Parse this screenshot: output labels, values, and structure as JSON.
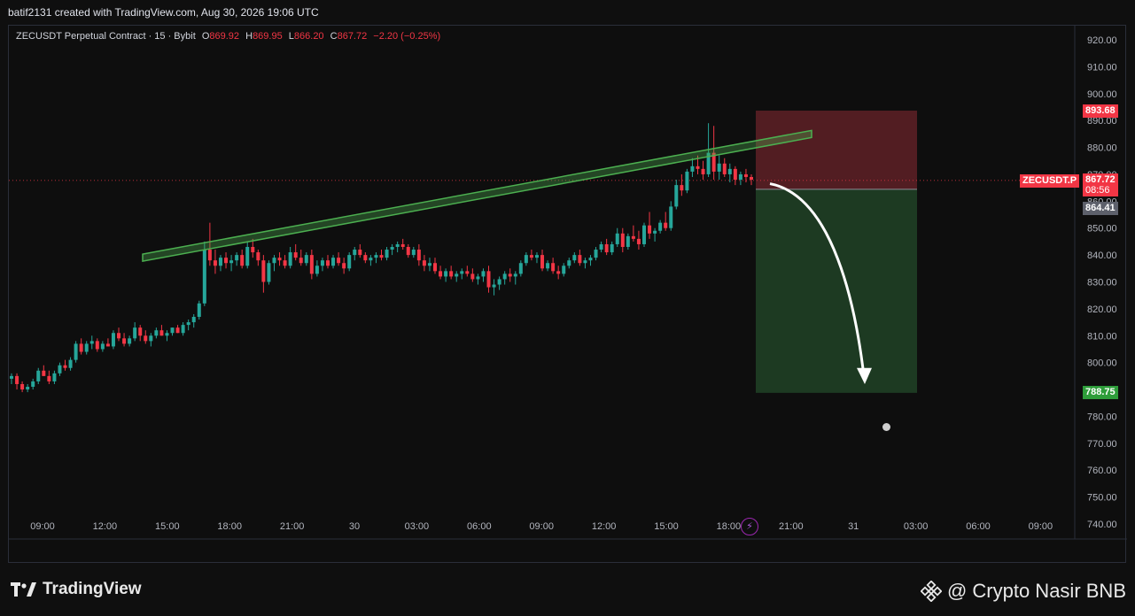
{
  "header": {
    "text": "batif2131 created with TradingView.com, Aug 30, 2026 19:06 UTC"
  },
  "legend": {
    "symbol": "ZECUSDT Perpetual Contract · 15 · Bybit",
    "o_key": "O",
    "o_val": "869.92",
    "h_key": "H",
    "h_val": "869.95",
    "l_key": "L",
    "l_val": "866.20",
    "c_key": "C",
    "c_val": "867.72",
    "change": "−2.20 (−0.25%)"
  },
  "price_axis": {
    "ticks": [
      "920.00",
      "910.00",
      "900.00",
      "890.00",
      "880.00",
      "870.00",
      "860.00",
      "850.00",
      "840.00",
      "830.00",
      "820.00",
      "810.00",
      "800.00",
      "790.00",
      "780.00",
      "770.00",
      "760.00",
      "750.00",
      "740.00"
    ]
  },
  "time_axis": {
    "ticks": [
      "09:00",
      "12:00",
      "15:00",
      "18:00",
      "21:00",
      "30",
      "03:00",
      "06:00",
      "09:00",
      "12:00",
      "15:00",
      "18:00",
      "21:00",
      "31",
      "03:00",
      "06:00",
      "09:00"
    ]
  },
  "price_tags": {
    "stop": "893.68",
    "symbol_label": "ZECUSDT.P",
    "last": "867.72",
    "countdown": "08:56",
    "entry": "864.41",
    "target": "788.75"
  },
  "colors": {
    "up": "#26a69a",
    "down": "#f23645",
    "trendline": "#4caf50",
    "stop_zone": "#5a1f25",
    "target_zone": "#1f3d24"
  },
  "branding": {
    "logo": "TradingView",
    "watermark": "@ Crypto Nasir BNB"
  },
  "icons": {
    "bolt": "lightning-icon",
    "clock": "clock-icon",
    "binance": "binance-icon"
  },
  "chart_data": {
    "type": "candlestick",
    "symbol": "ZECUSDT.P",
    "interval": "15",
    "ylim": [
      735,
      925
    ],
    "ohlc": [
      [
        794,
        796,
        792,
        795
      ],
      [
        795,
        796,
        790,
        792
      ],
      [
        792,
        793,
        789,
        790
      ],
      [
        790,
        792,
        789,
        791
      ],
      [
        791,
        794,
        790,
        793
      ],
      [
        793,
        798,
        792,
        797
      ],
      [
        797,
        799,
        795,
        795
      ],
      [
        795,
        797,
        792,
        793
      ],
      [
        793,
        797,
        792,
        796
      ],
      [
        796,
        800,
        795,
        799
      ],
      [
        799,
        801,
        797,
        798
      ],
      [
        798,
        802,
        797,
        801
      ],
      [
        801,
        808,
        800,
        807
      ],
      [
        807,
        809,
        803,
        804
      ],
      [
        804,
        808,
        803,
        807
      ],
      [
        807,
        810,
        805,
        808
      ],
      [
        808,
        809,
        804,
        805
      ],
      [
        805,
        808,
        804,
        807
      ],
      [
        807,
        809,
        806,
        806
      ],
      [
        806,
        812,
        805,
        811
      ],
      [
        811,
        813,
        808,
        809
      ],
      [
        809,
        811,
        806,
        807
      ],
      [
        807,
        810,
        806,
        809
      ],
      [
        809,
        815,
        808,
        813
      ],
      [
        813,
        814,
        808,
        810
      ],
      [
        810,
        812,
        807,
        808
      ],
      [
        808,
        811,
        806,
        810
      ],
      [
        810,
        813,
        809,
        812
      ],
      [
        812,
        814,
        810,
        810
      ],
      [
        810,
        812,
        808,
        811
      ],
      [
        811,
        813,
        810,
        813
      ],
      [
        813,
        814,
        811,
        811
      ],
      [
        811,
        815,
        810,
        814
      ],
      [
        814,
        816,
        812,
        815
      ],
      [
        815,
        818,
        813,
        817
      ],
      [
        817,
        823,
        816,
        822
      ],
      [
        822,
        845,
        821,
        842
      ],
      [
        842,
        852,
        836,
        838
      ],
      [
        838,
        842,
        833,
        836
      ],
      [
        836,
        840,
        834,
        839
      ],
      [
        839,
        841,
        835,
        837
      ],
      [
        837,
        840,
        834,
        838
      ],
      [
        838,
        841,
        836,
        840
      ],
      [
        840,
        842,
        835,
        836
      ],
      [
        836,
        845,
        835,
        843
      ],
      [
        843,
        846,
        839,
        841
      ],
      [
        841,
        842,
        836,
        838
      ],
      [
        838,
        840,
        826,
        830
      ],
      [
        830,
        838,
        829,
        837
      ],
      [
        837,
        840,
        834,
        839
      ],
      [
        839,
        841,
        836,
        838
      ],
      [
        838,
        840,
        835,
        836
      ],
      [
        836,
        843,
        835,
        841
      ],
      [
        841,
        844,
        838,
        839
      ],
      [
        839,
        842,
        836,
        837
      ],
      [
        837,
        841,
        836,
        840
      ],
      [
        840,
        842,
        831,
        833
      ],
      [
        833,
        838,
        832,
        836
      ],
      [
        836,
        839,
        834,
        838
      ],
      [
        838,
        840,
        835,
        836
      ],
      [
        836,
        840,
        835,
        839
      ],
      [
        839,
        841,
        836,
        837
      ],
      [
        837,
        839,
        833,
        835
      ],
      [
        835,
        841,
        834,
        840
      ],
      [
        840,
        843,
        838,
        842
      ],
      [
        842,
        844,
        839,
        840
      ],
      [
        840,
        841,
        837,
        838
      ],
      [
        838,
        840,
        836,
        839
      ],
      [
        839,
        841,
        837,
        840
      ],
      [
        840,
        842,
        838,
        839
      ],
      [
        839,
        843,
        838,
        842
      ],
      [
        842,
        844,
        840,
        843
      ],
      [
        843,
        845,
        841,
        844
      ],
      [
        844,
        846,
        842,
        843
      ],
      [
        843,
        844,
        839,
        840
      ],
      [
        840,
        843,
        839,
        842
      ],
      [
        842,
        844,
        836,
        838
      ],
      [
        838,
        840,
        834,
        836
      ],
      [
        836,
        839,
        834,
        837
      ],
      [
        837,
        839,
        833,
        834
      ],
      [
        834,
        836,
        831,
        832
      ],
      [
        832,
        835,
        830,
        834
      ],
      [
        834,
        836,
        831,
        832
      ],
      [
        832,
        834,
        830,
        833
      ],
      [
        833,
        835,
        831,
        834
      ],
      [
        834,
        836,
        832,
        833
      ],
      [
        833,
        835,
        830,
        831
      ],
      [
        831,
        833,
        829,
        832
      ],
      [
        832,
        835,
        830,
        834
      ],
      [
        834,
        836,
        826,
        828
      ],
      [
        828,
        831,
        825,
        829
      ],
      [
        829,
        832,
        827,
        831
      ],
      [
        831,
        834,
        829,
        833
      ],
      [
        833,
        835,
        830,
        832
      ],
      [
        832,
        834,
        829,
        833
      ],
      [
        833,
        838,
        832,
        837
      ],
      [
        837,
        841,
        836,
        840
      ],
      [
        840,
        842,
        838,
        839
      ],
      [
        839,
        841,
        837,
        840
      ],
      [
        840,
        842,
        834,
        835
      ],
      [
        835,
        838,
        834,
        837
      ],
      [
        837,
        839,
        833,
        834
      ],
      [
        834,
        836,
        831,
        833
      ],
      [
        833,
        837,
        832,
        836
      ],
      [
        836,
        839,
        835,
        838
      ],
      [
        838,
        841,
        837,
        840
      ],
      [
        840,
        842,
        836,
        837
      ],
      [
        837,
        839,
        835,
        838
      ],
      [
        838,
        840,
        836,
        839
      ],
      [
        839,
        843,
        838,
        842
      ],
      [
        842,
        845,
        841,
        844
      ],
      [
        844,
        846,
        840,
        841
      ],
      [
        841,
        845,
        840,
        844
      ],
      [
        844,
        850,
        843,
        848
      ],
      [
        848,
        850,
        841,
        843
      ],
      [
        843,
        848,
        842,
        847
      ],
      [
        847,
        851,
        845,
        846
      ],
      [
        846,
        849,
        842,
        844
      ],
      [
        844,
        852,
        843,
        851
      ],
      [
        851,
        856,
        846,
        848
      ],
      [
        848,
        850,
        845,
        849
      ],
      [
        849,
        853,
        848,
        852
      ],
      [
        852,
        856,
        849,
        850
      ],
      [
        850,
        860,
        849,
        858
      ],
      [
        858,
        868,
        857,
        866
      ],
      [
        866,
        870,
        862,
        864
      ],
      [
        864,
        872,
        863,
        871
      ],
      [
        871,
        876,
        869,
        873
      ],
      [
        873,
        877,
        870,
        872
      ],
      [
        872,
        875,
        868,
        870
      ],
      [
        870,
        889,
        869,
        878
      ],
      [
        878,
        888,
        868,
        871
      ],
      [
        871,
        877,
        868,
        874
      ],
      [
        874,
        876,
        869,
        870
      ],
      [
        870,
        874,
        867,
        872
      ],
      [
        872,
        873,
        866,
        868
      ],
      [
        868,
        871,
        866,
        870
      ],
      [
        870,
        872,
        867,
        869
      ],
      [
        869,
        870,
        866,
        868
      ]
    ],
    "trendline": {
      "start": 839,
      "end": 885
    },
    "position": {
      "side": "short",
      "entry": 864.41,
      "stop": 893.68,
      "target": 788.75
    },
    "last_price": 867.72
  }
}
